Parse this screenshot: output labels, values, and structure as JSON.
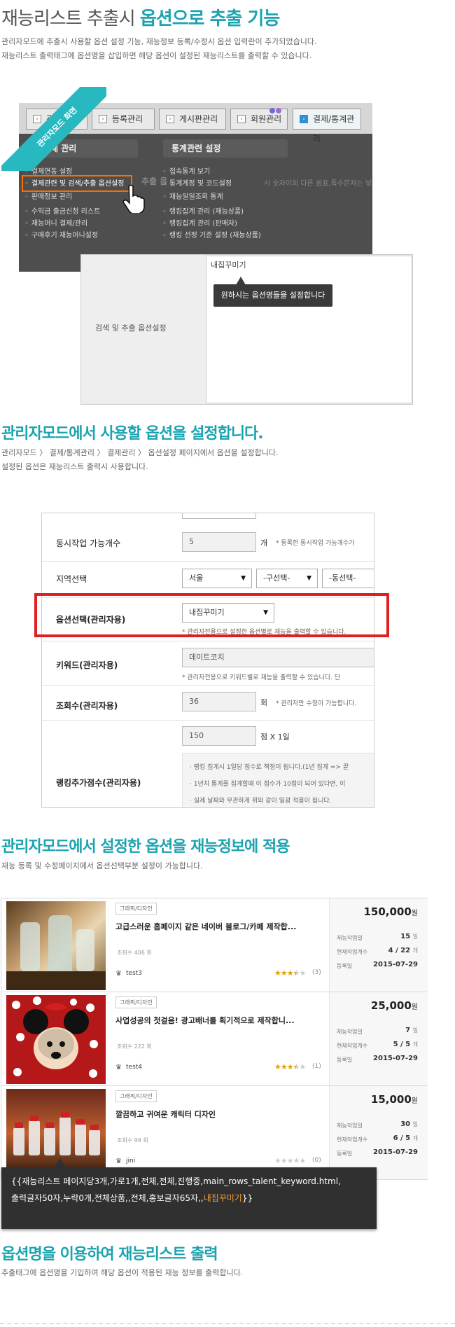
{
  "header": {
    "title_plain": "재능리스트 추출시 ",
    "title_accent": "옵션으로 추출 기능",
    "desc_line1": "관리자모드에 추출시 사용할 옵션 설정 기능, 재능정보 등록/수정시 옵션 입력란이 추가되었습니다.",
    "desc_line2": "재능리스트 출력태그에 옵션명을 삽입하면 해당 옵션이 설정된 재능리스트를 출력할 수 있습니다."
  },
  "admin_screen": {
    "ribbon_label": "관리자모드 화면",
    "tabs": [
      "관리",
      "등록관리",
      "게시판관리",
      "회원관리",
      "결제/통계관리"
    ],
    "left_section_title": "결제 관리",
    "right_section_title": "통계관련 설정",
    "left_menu": [
      "결제연동 설정",
      "결제관련 및 검색/추출 옵션설정",
      "판매정보 관리",
      "수익금 출금신청 리스트",
      "재능머니 결제/관리",
      "구매후기 재능머니설정"
    ],
    "right_menu": [
      "접속통계 보기",
      "통계계정 및 코드설정",
      "재능일일조회 통계",
      "랭킹집계 관리 (재능상품)",
      "랭킹집계 관리 (판매자)",
      "랭킹 선정 기준 설정 (재능상품)"
    ],
    "bg_text": "추출 옵",
    "bg_text2": "시 숫자이외 다른 쉼표,특수문자는 넣기"
  },
  "option_panel": {
    "label": "검색 및 추출 옵션설정",
    "value": "내집꾸미기",
    "tooltip": "원하시는 옵션명들을 설정합니다"
  },
  "section2": {
    "title": "관리자모드에서 사용할 옵션을 설정합니다.",
    "desc_line1": "관리자모드 〉 결제/통계관리 〉 결제관리 〉 옵션설정 페이지에서 옵션을 설정합니다.",
    "desc_line2": "설정된 옵션은 재능리스트 출력시 사용합니다."
  },
  "form": {
    "concurrent_label": "동시작업 가능개수",
    "concurrent_value": "5",
    "concurrent_unit": "개",
    "concurrent_note": "* 등록한 동시작업 가능개수가",
    "region_label": "지역선택",
    "region_value": "서울",
    "district_value": "-구선택-",
    "dong_value": "-동선택-",
    "option_label": "옵션선택(관리자용)",
    "option_value": "내집꾸미기",
    "option_note": "* 관리자전용으로 설정한 옵션별로 재능을 출력할 수 있습니다.",
    "keyword_label": "키워드(관리자용)",
    "keyword_value": "데이트코치",
    "keyword_note": "* 관리자전용으로 키워드별로 재능을 출력할 수 있습니다. 단",
    "views_label": "조회수(관리자용)",
    "views_value": "36",
    "views_unit": "회",
    "views_note": "* 관리자만 수정이 가능합니다.",
    "rank_value": "150",
    "rank_unit": "점 X 1일",
    "rank_label": "랭킹추가점수(관리자용)",
    "rank_note1": "· 랭킹 집계시 1일당 점수로 책정이 됩니다.(1년 집계 => 끝",
    "rank_note2": "· 1년치 통계를 집계할때 이 점수가 10점이 되어 있다면, 이",
    "rank_note3": "· 실제 날짜와 무관하게 위와 같이 일괄 적용이 됩니다."
  },
  "section3": {
    "title": "관리자모드에서 설정한 옵션을 재능정보에 적용",
    "desc": "재능 등록 및 수정페이지에서 옵션선택부분 설정이 가능합니다."
  },
  "listings": [
    {
      "category": "그래픽/디자인",
      "title": "고급스러운 홈페이지 같은 네이버 블로그/카페 제작합...",
      "views": "조회수 406 회",
      "seller": "test3",
      "rating": 3.5,
      "reviews": "(3)",
      "price": "150,000",
      "price_unit": "원",
      "work_days_label": "재능작업일",
      "work_days": "15",
      "work_days_unit": "일",
      "jobs_label": "현재작업개수",
      "jobs": "4 / 22",
      "jobs_unit": "개",
      "date_label": "등록일",
      "date": "2015-07-29"
    },
    {
      "category": "그래픽/디자인",
      "title": "사업성공의 첫걸음! 광고배너를 획기적으로 제작합니...",
      "views": "조회수 222 회",
      "seller": "test4",
      "rating": 3.5,
      "reviews": "(1)",
      "price": "25,000",
      "price_unit": "원",
      "work_days_label": "재능작업일",
      "work_days": "7",
      "work_days_unit": "일",
      "jobs_label": "현재작업개수",
      "jobs": "5 / 5",
      "jobs_unit": "개",
      "date_label": "등록일",
      "date": "2015-07-29"
    },
    {
      "category": "그래픽/디자인",
      "title": "깔끔하고 귀여운 캐릭터 디자인",
      "views": "조회수 99 회",
      "seller": "jini",
      "rating": 0,
      "reviews": "(0)",
      "price": "15,000",
      "price_unit": "원",
      "work_days_label": "재능작업일",
      "work_days": "30",
      "work_days_unit": "일",
      "jobs_label": "현재작업개수",
      "jobs": "6 / 5",
      "jobs_unit": "개",
      "date_label": "등록일",
      "date": "2015-07-29"
    }
  ],
  "code": {
    "line1": "{{재능리스트 페이지당3개,가로1개,전체,전체,진행중,main_rows_talent_keyword.html,",
    "line2_prefix": "출력글자50자,누락0개,전체상품,,전체,홍보글자65자,,",
    "line2_highlight": "내집꾸미기",
    "line2_suffix": "}}"
  },
  "section4": {
    "title": "옵션명을 이용하여 재능리스트 출력",
    "desc": "추출태그에 옵션명을 기입하여 해당 옵션이 적용된 재능 정보를 출력합니다."
  },
  "colors": {
    "accent": "#1ba3b0",
    "highlight_border": "#e02020",
    "menu_highlight": "#ff6b00"
  }
}
